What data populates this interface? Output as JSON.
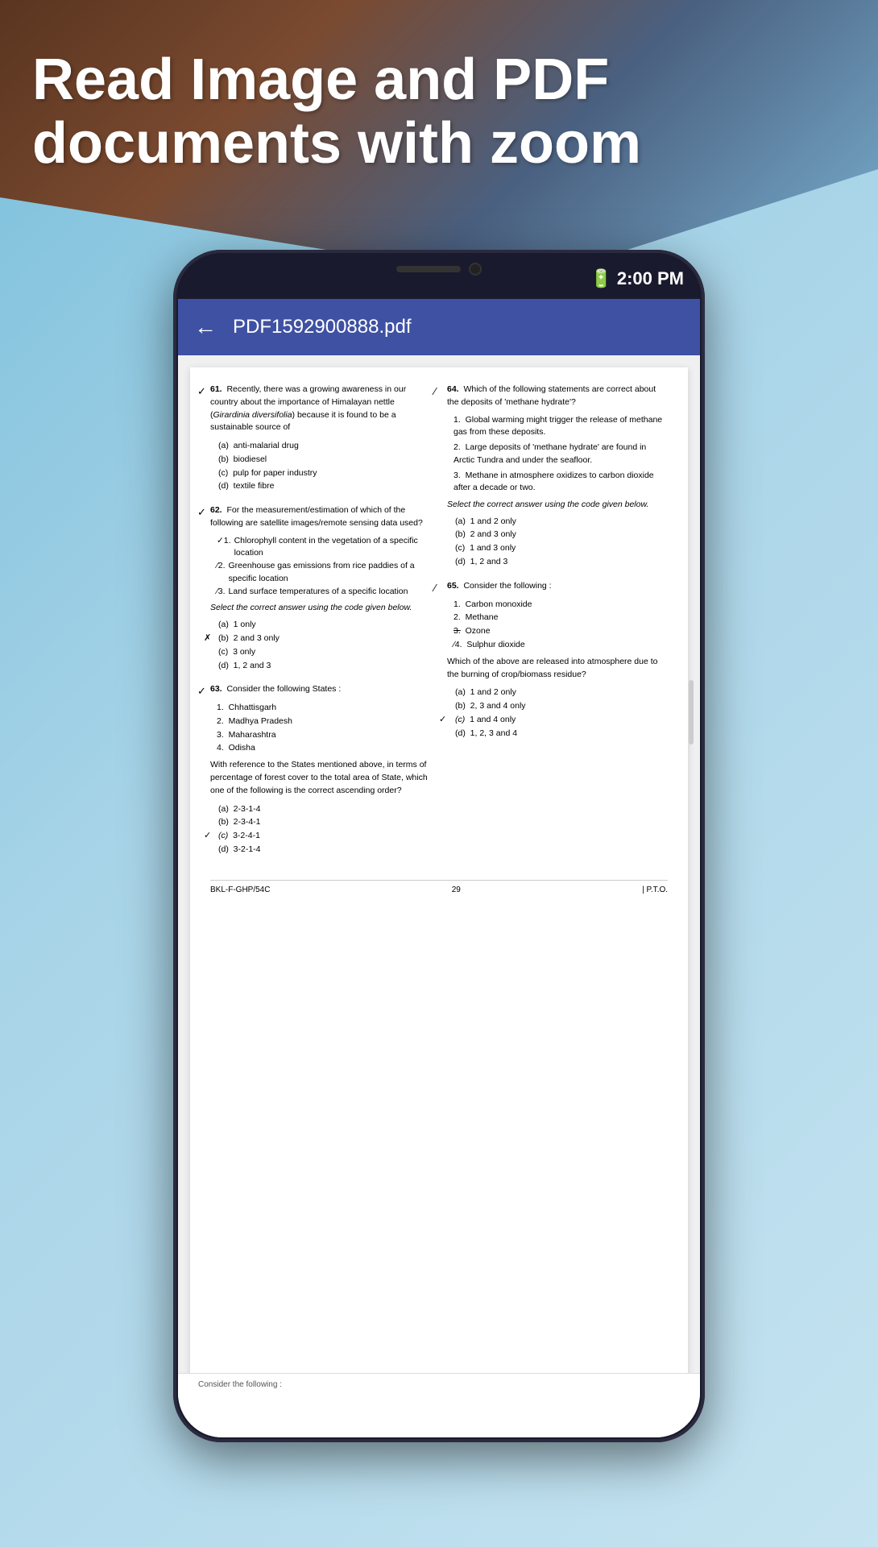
{
  "background": {
    "gradient_start": "#7bbfdb",
    "gradient_end": "#c5e3f0"
  },
  "title": {
    "line1": "Read Image and PDF",
    "line2": "documents with zoom"
  },
  "status_bar": {
    "time": "2:00 PM",
    "battery_icon": "🔋"
  },
  "app_bar": {
    "back_label": "←",
    "title": "PDF1592900888.pdf"
  },
  "pdf": {
    "page_number": "29",
    "footer_left": "BKL-F-GHP/54C",
    "footer_right": "| P.T.O.",
    "questions": [
      {
        "id": "q61",
        "number": "61.",
        "text": "Recently, there was a growing awareness in our country about the importance of Himalayan nettle (Girardinia diversifolia) because it is found to be a sustainable source of",
        "options": [
          "(a)  anti-malarial drug",
          "(b)  biodiesel",
          "(c)  pulp for paper industry",
          "(d)  textile fibre"
        ]
      },
      {
        "id": "q62",
        "number": "62.",
        "text": "For the measurement/estimation of which of the following are satellite images/remote sensing data used?",
        "numbered_items": [
          "Chlorophyll content in the vegetation of a specific location",
          "Greenhouse gas emissions from rice paddies of a specific location",
          "Land surface temperatures of a specific location"
        ],
        "select_text": "Select the correct answer using the code given below.",
        "options": [
          "(a)  1 only",
          "(b)  2 and 3 only",
          "(c)  3 only",
          "(d)  1, 2 and 3"
        ]
      },
      {
        "id": "q63",
        "number": "63.",
        "text": "Consider the following States :",
        "numbered_items": [
          "Chhattisgarh",
          "Madhya Pradesh",
          "Maharashtra",
          "Odisha"
        ],
        "sub_text": "With reference to the States mentioned above, in terms of percentage of forest cover to the total area of State, which one of the following is the correct ascending order?",
        "options": [
          "(a)  2-3-1-4",
          "(b)  2-3-4-1",
          "(c)  3-2-4-1",
          "(d)  3-2-1-4"
        ]
      },
      {
        "id": "q64",
        "number": "64.",
        "text": "Which of the following statements are correct about the deposits of 'methane hydrate'?",
        "numbered_items": [
          "Global warming might trigger the release of methane gas from these deposits.",
          "Large deposits of 'methane hydrate' are found in Arctic Tundra and under the seafloor.",
          "Methane in atmosphere oxidizes to carbon dioxide after a decade or two."
        ],
        "select_text": "Select the correct answer using the code given below.",
        "options": [
          "(a)  1 and 2 only",
          "(b)  2 and 3 only",
          "(c)  1 and 3 only",
          "(d)  1, 2 and 3"
        ]
      },
      {
        "id": "q65",
        "number": "65.",
        "text": "Consider the following :",
        "numbered_items": [
          "Carbon monoxide",
          "Methane",
          "Ozone",
          "Sulphur dioxide"
        ],
        "sub_text": "Which of the above are released into atmosphere due to the burning of crop/biomass residue?",
        "options": [
          "(a)  1 and 2 only",
          "(b)  2, 3 and 4 only",
          "(c)  1 and 4 only",
          "(d)  1, 2, 3 and 4"
        ]
      }
    ],
    "bottom_partial": "Consider the following :"
  }
}
